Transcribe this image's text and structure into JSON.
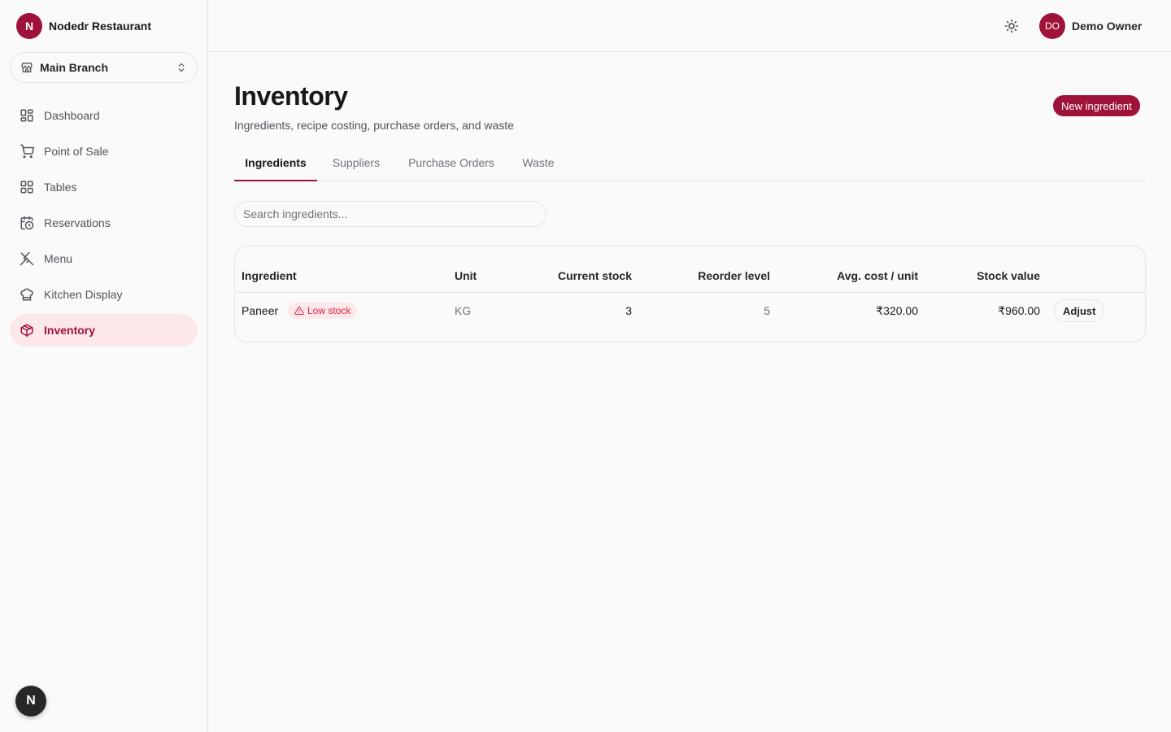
{
  "brand": {
    "logo_letter": "N",
    "name": "Nodedr Restaurant",
    "accent": "#9f1239"
  },
  "branch": {
    "selected": "Main Branch"
  },
  "sidebar": {
    "items": [
      {
        "label": "Dashboard",
        "icon": "dashboard-icon"
      },
      {
        "label": "Point of Sale",
        "icon": "cart-icon"
      },
      {
        "label": "Tables",
        "icon": "grid-icon"
      },
      {
        "label": "Reservations",
        "icon": "calendar-clock-icon"
      },
      {
        "label": "Menu",
        "icon": "utensils-icon"
      },
      {
        "label": "Kitchen Display",
        "icon": "chef-hat-icon"
      },
      {
        "label": "Inventory",
        "icon": "package-icon",
        "active": true
      }
    ]
  },
  "bottom_badge": {
    "letter": "N"
  },
  "topbar": {
    "theme_icon": "sun-icon",
    "user": {
      "initials": "DO",
      "name": "Demo Owner"
    }
  },
  "page": {
    "title": "Inventory",
    "subtitle": "Ingredients, recipe costing, purchase orders, and waste",
    "new_button": "New ingredient"
  },
  "tabs": [
    {
      "label": "Ingredients",
      "active": true
    },
    {
      "label": "Suppliers"
    },
    {
      "label": "Purchase Orders"
    },
    {
      "label": "Waste"
    }
  ],
  "search": {
    "placeholder": "Search ingredients...",
    "value": ""
  },
  "table": {
    "columns": [
      "Ingredient",
      "Unit",
      "Current stock",
      "Reorder level",
      "Avg. cost / unit",
      "Stock value"
    ],
    "rows": [
      {
        "ingredient": "Paneer",
        "badge": "Low stock",
        "unit": "KG",
        "current_stock": "3",
        "reorder_level": "5",
        "avg_cost": "₹320.00",
        "stock_value": "₹960.00",
        "action": "Adjust"
      }
    ]
  }
}
